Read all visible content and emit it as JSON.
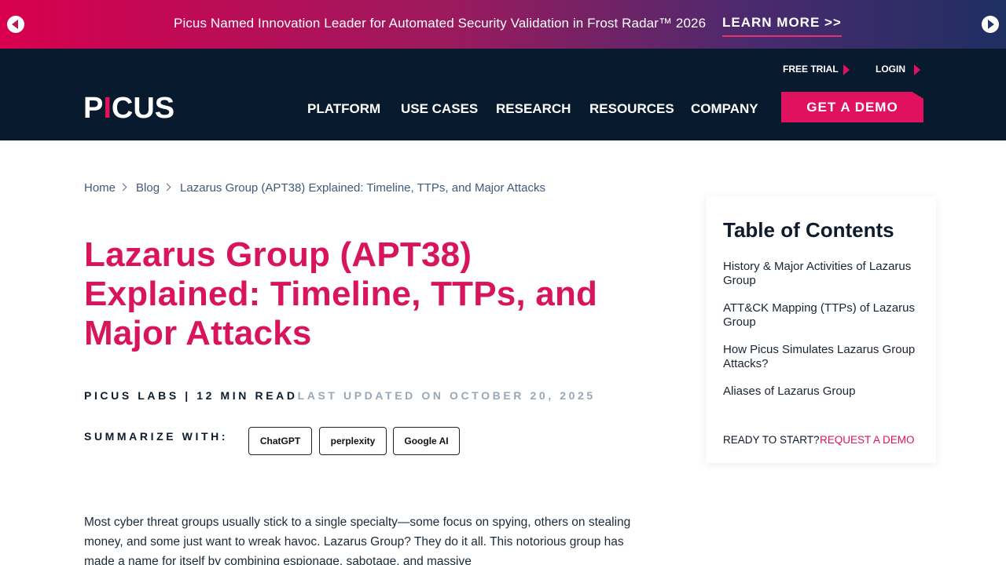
{
  "promo": {
    "text": "Picus Named Innovation Leader for Automated Security Validation in Frost Radar™ 2026",
    "link": "LEARN MORE >>",
    "prev_icon": "arrow-left-circle-icon",
    "next_icon": "arrow-right-circle-icon"
  },
  "header": {
    "utility": {
      "free_trial": "FREE TRIAL",
      "login": "LOGIN"
    },
    "logo": {
      "part1": "P",
      "accent": "I",
      "part2": "CUS"
    },
    "nav": [
      "PLATFORM",
      "USE CASES",
      "RESEARCH",
      "RESOURCES",
      "COMPANY"
    ],
    "demo_button": "GET A DEMO"
  },
  "breadcrumb": {
    "home": "Home",
    "blog": "Blog",
    "current": "Lazarus Group (APT38) Explained: Timeline, TTPs, and Major Attacks"
  },
  "article": {
    "title": "Lazarus Group (APT38) Explained: Timeline, TTPs, and Major Attacks",
    "author_read": "PICUS LABS | 12 MIN READ",
    "updated": "LAST UPDATED ON OCTOBER 20, 2025",
    "summarize_label": "SUMMARIZE WITH:",
    "summarize_buttons": [
      "ChatGPT",
      "perplexity",
      "Google AI"
    ],
    "intro": "Most cyber threat groups usually stick to a single specialty—some focus on spying, others on stealing money, and some just want to wreak havoc. Lazarus Group? They do it all. This notorious group has made a name for itself by combining espionage, sabotage, and massive"
  },
  "toc": {
    "title": "Table of Contents",
    "items": [
      "History & Major Activities of Lazarus Group",
      "ATT&CK Mapping (TTPs) of Lazarus Group",
      "How Picus Simulates Lazarus Group Attacks?",
      "Aliases of Lazarus Group"
    ],
    "ready": "READY TO START?",
    "cta": "REQUEST A DEMO"
  },
  "colors": {
    "brand_pink": "#e0115f",
    "title_pink": "#d8145c",
    "header_navy": "#081a2d"
  }
}
